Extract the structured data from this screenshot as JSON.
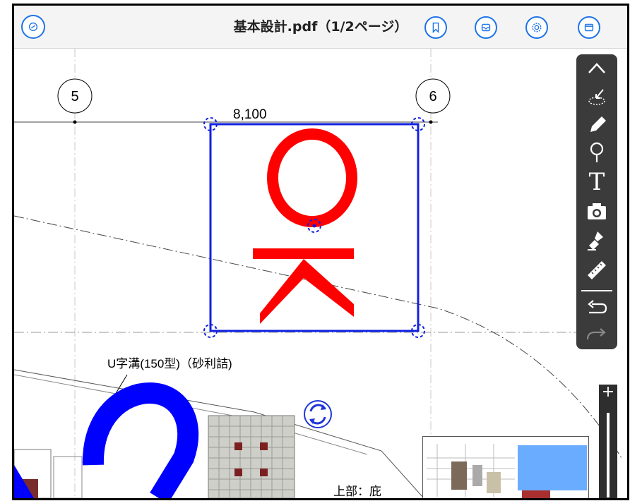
{
  "header": {
    "title": "基本設計.pdf（1/2ページ）",
    "buttons": [
      {
        "name": "bookmark-icon"
      },
      {
        "name": "inbox-icon"
      },
      {
        "name": "settings-gear-icon"
      },
      {
        "name": "window-icon"
      }
    ],
    "accent": "#1f74e8"
  },
  "drawing": {
    "grid_markers": [
      "5",
      "6"
    ],
    "dimension": "8,100",
    "label": "U字溝(150型)（砂利詰)",
    "label2": "上部：庇",
    "stamp_text": "OK",
    "stamp_color": "#ff0000",
    "selection_color": "#1020e0",
    "shape_color": "#0000ff"
  },
  "tools": [
    {
      "name": "collapse-chevron-icon"
    },
    {
      "name": "lasso-select-icon"
    },
    {
      "name": "pencil-icon"
    },
    {
      "name": "pin-icon"
    },
    {
      "name": "text-tool-icon"
    },
    {
      "name": "camera-icon"
    },
    {
      "name": "stamp-icon"
    },
    {
      "name": "ruler-icon"
    },
    {
      "name": "undo-icon"
    },
    {
      "name": "redo-icon"
    }
  ],
  "zoom": {
    "plus_label": "+"
  }
}
